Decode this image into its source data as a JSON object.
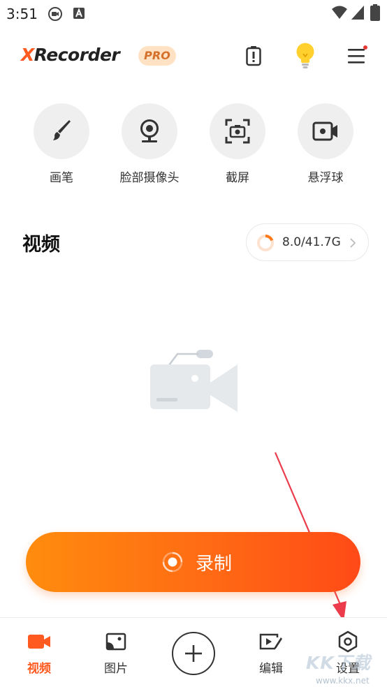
{
  "status_bar": {
    "time": "3:51"
  },
  "header": {
    "logo_x": "X",
    "logo_rest": "Recorder",
    "badge": "PRO"
  },
  "tools": [
    {
      "label": "画笔",
      "icon": "brush-icon"
    },
    {
      "label": "脸部摄像头",
      "icon": "webcam-icon"
    },
    {
      "label": "截屏",
      "icon": "screenshot-icon"
    },
    {
      "label": "悬浮球",
      "icon": "floating-ball-icon"
    }
  ],
  "videos": {
    "title": "视频",
    "storage": "8.0/41.7G",
    "storage_fraction": 0.19
  },
  "record": {
    "label": "录制"
  },
  "bottom_nav": [
    {
      "label": "视频",
      "icon": "video-icon",
      "active": true
    },
    {
      "label": "图片",
      "icon": "image-icon",
      "active": false
    },
    {
      "label": "编辑",
      "icon": "edit-video-icon",
      "active": false
    },
    {
      "label": "设置",
      "icon": "settings-icon",
      "active": false
    }
  ],
  "watermark": {
    "text": "KK下载",
    "url": "www.kkx.net"
  },
  "colors": {
    "accent": "#ff5a1f",
    "gradient_start": "#ff8c0e",
    "gradient_end": "#ff4a17",
    "notification_dot": "#e53935"
  }
}
